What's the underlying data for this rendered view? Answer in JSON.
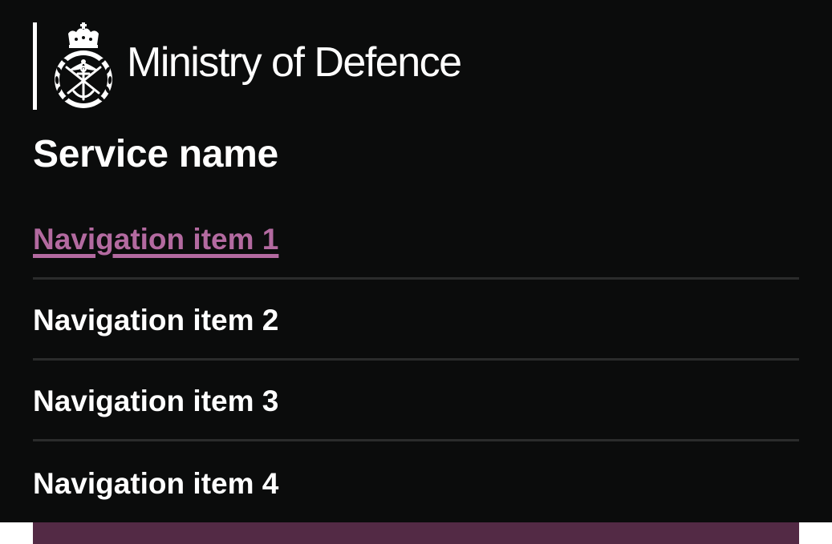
{
  "header": {
    "org_name": "Ministry of Defence",
    "logo_icon": "mod-crest-icon",
    "service_name": "Service name",
    "background_color": "#0b0c0c"
  },
  "navigation": {
    "items": [
      {
        "label": "Navigation item 1",
        "active": true
      },
      {
        "label": "Navigation item 2",
        "active": false
      },
      {
        "label": "Navigation item 3",
        "active": false
      },
      {
        "label": "Navigation item 4",
        "active": false
      }
    ],
    "active_color": "#b36aa0",
    "divider_color": "#2b2c2c"
  },
  "accent": {
    "brand_color": "#532a45"
  }
}
